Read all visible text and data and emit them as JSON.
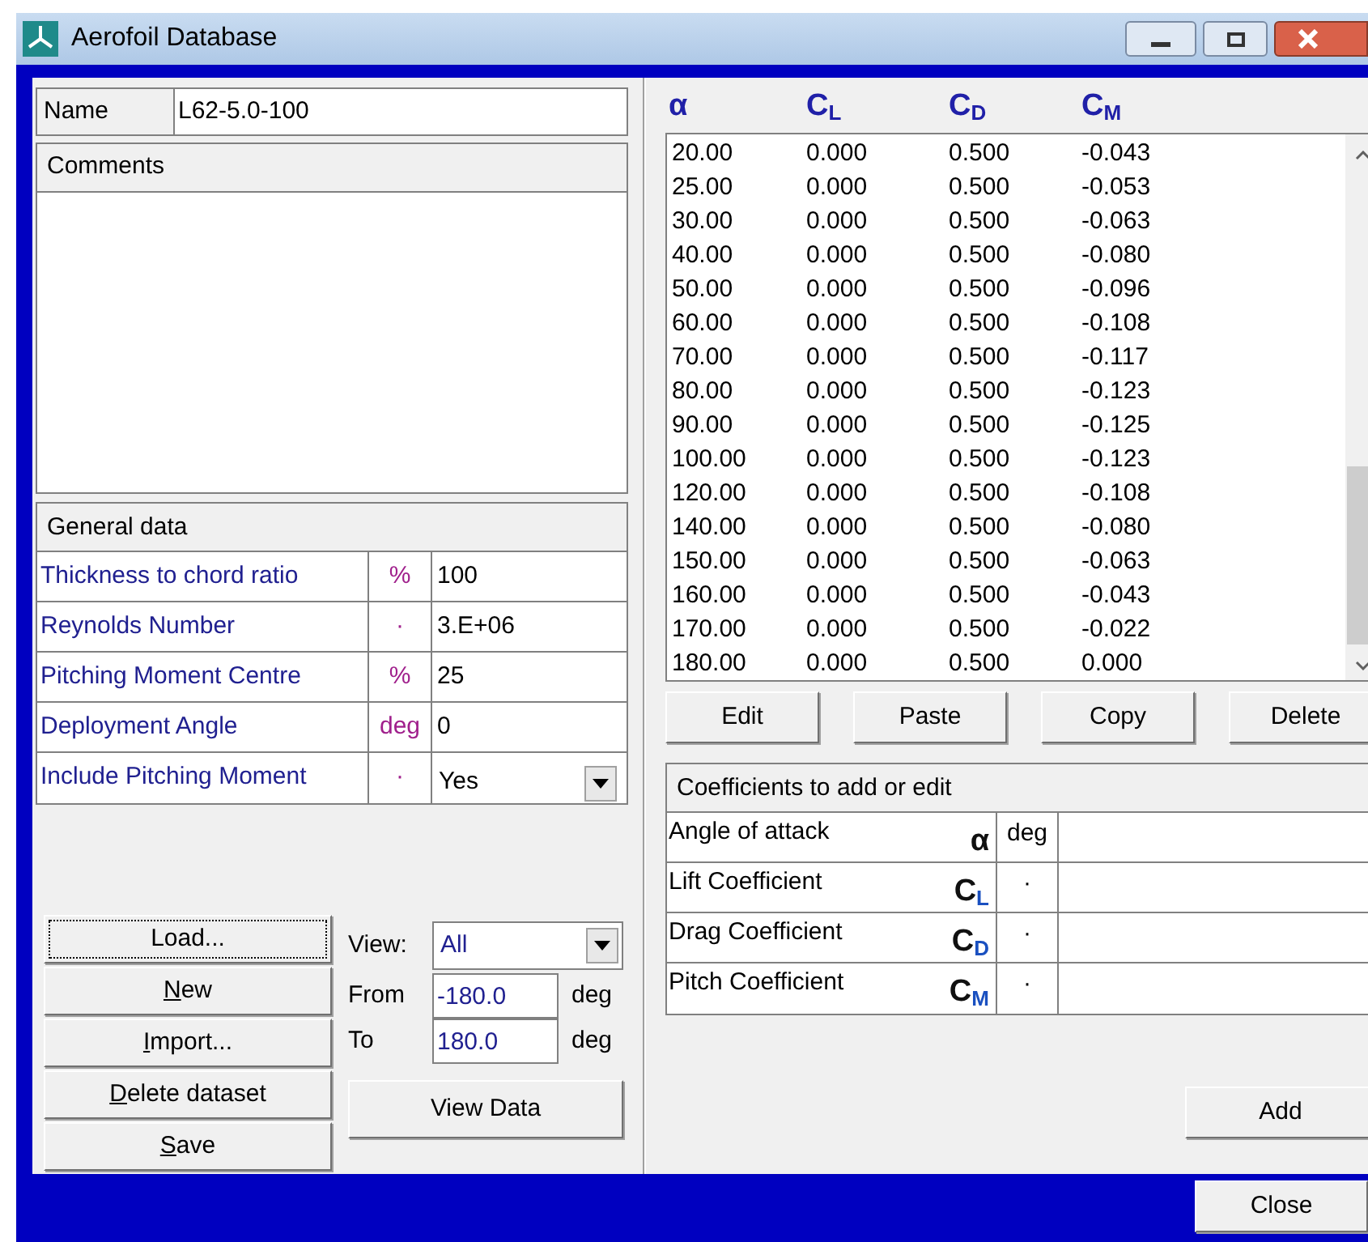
{
  "window": {
    "title": "Aerofoil Database"
  },
  "name_field": {
    "label": "Name",
    "value": "L62-5.0-100"
  },
  "comments": {
    "title": "Comments"
  },
  "general_data": {
    "title": "General data",
    "rows": [
      {
        "kind": "text",
        "label": "Thickness to chord ratio",
        "unit": "%",
        "value": "100"
      },
      {
        "kind": "text",
        "label": "Reynolds Number",
        "unit": "·",
        "value": "3.E+06"
      },
      {
        "kind": "text",
        "label": "Pitching Moment Centre",
        "unit": "%",
        "value": "25"
      },
      {
        "kind": "text",
        "label": "Deployment Angle",
        "unit": "deg",
        "value": "0"
      },
      {
        "kind": "dropdown",
        "label": "Include Pitching Moment",
        "unit": "·",
        "value": "Yes"
      }
    ]
  },
  "actions": [
    {
      "label": "Load...",
      "access_key_underlined": false,
      "focused": true
    },
    {
      "label": "New",
      "access_key_underlined": true,
      "focused": false
    },
    {
      "label": "Import...",
      "access_key_underlined": true,
      "focused": false
    },
    {
      "label": "Delete dataset",
      "access_key_underlined": true,
      "focused": false
    },
    {
      "label": "Save",
      "access_key_underlined": true,
      "focused": false
    }
  ],
  "view": {
    "label": "View:",
    "value": "All",
    "from_label": "From",
    "from_value": "-180.0",
    "to_label": "To",
    "to_value": "180.0",
    "from_unit": "deg",
    "to_unit": "deg",
    "button": "View Data"
  },
  "table": {
    "columns": [
      "α",
      "C$_{L}$",
      "C$_{D}$",
      "C$_{M}$"
    ],
    "rows": [
      [
        "20.00",
        "0.000",
        "0.500",
        "-0.043"
      ],
      [
        "25.00",
        "0.000",
        "0.500",
        "-0.053"
      ],
      [
        "30.00",
        "0.000",
        "0.500",
        "-0.063"
      ],
      [
        "40.00",
        "0.000",
        "0.500",
        "-0.080"
      ],
      [
        "50.00",
        "0.000",
        "0.500",
        "-0.096"
      ],
      [
        "60.00",
        "0.000",
        "0.500",
        "-0.108"
      ],
      [
        "70.00",
        "0.000",
        "0.500",
        "-0.117"
      ],
      [
        "80.00",
        "0.000",
        "0.500",
        "-0.123"
      ],
      [
        "90.00",
        "0.000",
        "0.500",
        "-0.125"
      ],
      [
        "100.00",
        "0.000",
        "0.500",
        "-0.123"
      ],
      [
        "120.00",
        "0.000",
        "0.500",
        "-0.108"
      ],
      [
        "140.00",
        "0.000",
        "0.500",
        "-0.080"
      ],
      [
        "150.00",
        "0.000",
        "0.500",
        "-0.063"
      ],
      [
        "160.00",
        "0.000",
        "0.500",
        "-0.043"
      ],
      [
        "170.00",
        "0.000",
        "0.500",
        "-0.022"
      ],
      [
        "180.00",
        "0.000",
        "0.500",
        "0.000"
      ]
    ]
  },
  "table_buttons": [
    "Edit",
    "Paste",
    "Copy",
    "Delete"
  ],
  "coefficients": {
    "title": "Coefficients to add or edit",
    "rows": [
      {
        "label": "Angle of attack",
        "symbol": "α",
        "unit": "deg"
      },
      {
        "label": "Lift Coefficient",
        "symbol": "C$_{L}$",
        "unit": "·"
      },
      {
        "label": "Drag Coefficient",
        "symbol": "C$_{D}$",
        "unit": "·"
      },
      {
        "label": "Pitch Coefficient",
        "symbol": "C$_{M}$",
        "unit": "·"
      }
    ]
  },
  "add_button": "Add",
  "close_button": "Close"
}
